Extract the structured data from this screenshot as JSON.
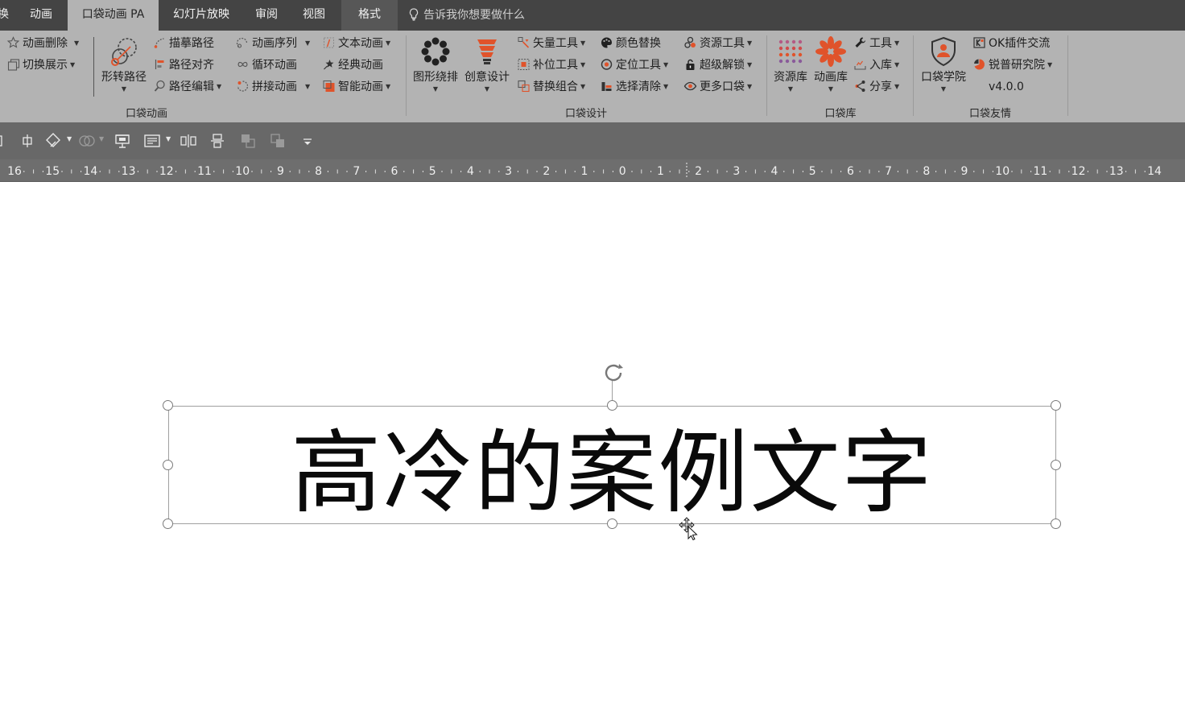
{
  "tabs": [
    {
      "label": "换",
      "name": "tab-transitions"
    },
    {
      "label": "动画",
      "name": "tab-animations"
    },
    {
      "label": "口袋动画 PA",
      "name": "tab-pocket-animation"
    },
    {
      "label": "幻灯片放映",
      "name": "tab-slideshow"
    },
    {
      "label": "审阅",
      "name": "tab-review"
    },
    {
      "label": "视图",
      "name": "tab-view"
    },
    {
      "label": "格式",
      "name": "tab-format"
    }
  ],
  "tell_me": "告诉我你想要做什么",
  "ribbon": {
    "groups": {
      "pocket_animation": "口袋动画",
      "pocket_design": "口袋设计",
      "pocket_library": "口袋库",
      "pocket_friends": "口袋友情"
    },
    "pa": {
      "anim_delete": "动画删除",
      "switch_show": "切换展示",
      "shape_path": "形转路径",
      "trace_path": "描摹路径",
      "path_align": "路径对齐",
      "path_edit": "路径编辑",
      "anim_sequence": "动画序列",
      "loop_anim": "循环动画",
      "splice_anim": "拼接动画",
      "text_anim": "文本动画",
      "classic_anim": "经典动画",
      "smart_anim": "智能动画"
    },
    "design": {
      "shape_wrap": "图形绕排",
      "creative_design": "创意设计",
      "vector_tools": "矢量工具",
      "patch_tools": "补位工具",
      "replace_group": "替换组合",
      "color_replace": "颜色替换",
      "position_tools": "定位工具",
      "select_clear": "选择清除",
      "resource_tools": "资源工具",
      "super_unlock": "超级解锁",
      "more_pockets": "更多口袋"
    },
    "library": {
      "resource_lib": "资源库",
      "anim_lib": "动画库",
      "tools": "工具",
      "import": "入库",
      "share": "分享"
    },
    "friends": {
      "academy": "口袋学院",
      "ok_plugin": "OK插件交流",
      "ruipu": "锐普研究院",
      "version": "v4.0.0"
    }
  },
  "ruler": {
    "labels": [
      "16",
      "15",
      "14",
      "13",
      "12",
      "11",
      "10",
      "9",
      "8",
      "7",
      "6",
      "5",
      "4",
      "3",
      "2",
      "1",
      "0",
      "1",
      "2",
      "3",
      "4",
      "5",
      "6",
      "7",
      "8",
      "9",
      "10",
      "11",
      "12",
      "13",
      "14"
    ]
  },
  "slide": {
    "text": "高冷的案例文字"
  },
  "colors": {
    "accent_orange": "#e0532b",
    "ribbon_bg": "#b3b3b3",
    "tab_bg": "#444444"
  }
}
